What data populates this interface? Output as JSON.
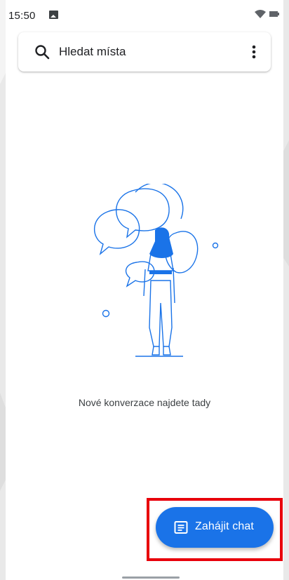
{
  "status_bar": {
    "time": "15:50",
    "icons": [
      "image-icon",
      "wifi-icon",
      "battery-icon"
    ]
  },
  "search": {
    "placeholder": "Hledat místa",
    "icon": "search-icon",
    "menu_icon": "more-vert-icon"
  },
  "main": {
    "empty_state_text": "Nové konverzace najdete tady",
    "illustration": "woman-with-speech-bubbles-illustration"
  },
  "fab": {
    "label": "Zahájit chat",
    "icon": "chat-icon"
  },
  "colors": {
    "accent": "#1a73e8",
    "highlight": "#e8000b"
  }
}
